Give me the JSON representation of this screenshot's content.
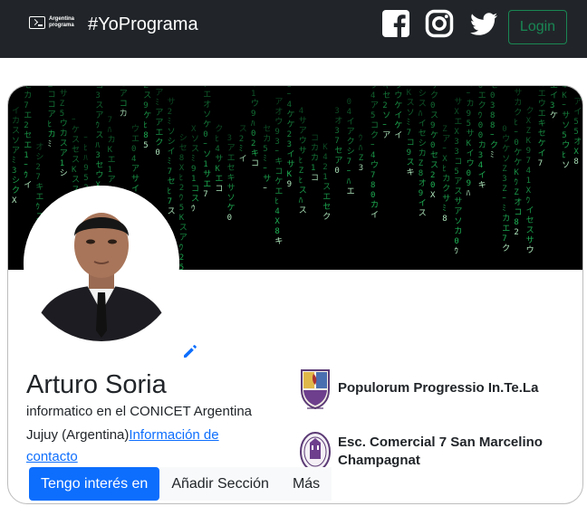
{
  "navbar": {
    "logo_text_line1": "Argentina",
    "logo_text_line2": "programa",
    "title": "#YoPrograma",
    "social_icons": [
      "facebook-icon",
      "instagram-icon",
      "twitter-icon"
    ],
    "login_label": "Login"
  },
  "profile": {
    "name": "Arturo Soria",
    "headline": "informatico en el CONICET Argentina",
    "location": "Jujuy (Argentina)",
    "contact_link": "Información de contacto"
  },
  "education": [
    {
      "name": "Populorum Progressio In.Te.La",
      "icon": "school-crest-icon"
    },
    {
      "name": "Esc. Comercial 7 San Marcelino Champagnat",
      "icon": "school-seal-icon"
    }
  ],
  "actions": {
    "primary": "Tengo interés en",
    "add_section": "Añadir Sección",
    "more": "Más"
  },
  "colors": {
    "navbar_bg": "#212529",
    "login_outline": "#198754",
    "primary": "#0d6efd",
    "link": "#0d6efd",
    "banner_rain": "#22c55e"
  }
}
